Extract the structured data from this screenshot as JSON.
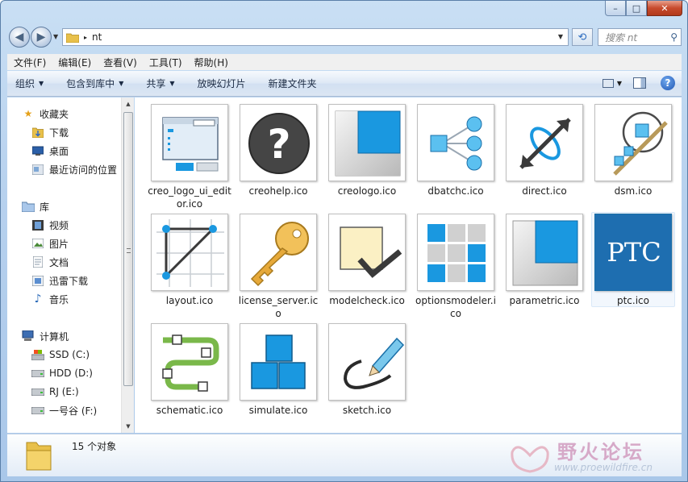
{
  "window": {
    "caption_minimize": "–",
    "caption_maximize": "□",
    "caption_close": "✕"
  },
  "address_bar": {
    "separator": "▸",
    "path": "nt",
    "search_placeholder": "搜索 nt"
  },
  "menu": [
    "文件(F)",
    "编辑(E)",
    "查看(V)",
    "工具(T)",
    "帮助(H)"
  ],
  "toolbar": {
    "organize": "组织",
    "include_in_library": "包含到库中",
    "share": "共享",
    "slideshow": "放映幻灯片",
    "new_folder": "新建文件夹"
  },
  "nav_pane": {
    "favorites": {
      "label": "收藏夹",
      "items": [
        "下载",
        "桌面",
        "最近访问的位置"
      ]
    },
    "libraries": {
      "label": "库",
      "items": [
        "视频",
        "图片",
        "文档",
        "迅雷下载",
        "音乐"
      ]
    },
    "computer": {
      "label": "计算机",
      "items": [
        "SSD (C:)",
        "HDD (D:)",
        "RJ (E:)",
        "一号谷 (F:)"
      ]
    }
  },
  "files": [
    {
      "name": "creo_logo_ui_editor.ico",
      "icon": "ui-editor-icon"
    },
    {
      "name": "creohelp.ico",
      "icon": "help-question-icon"
    },
    {
      "name": "creologo.ico",
      "icon": "creo-logo-icon"
    },
    {
      "name": "dbatchc.ico",
      "icon": "batch-nodes-icon"
    },
    {
      "name": "direct.ico",
      "icon": "direct-arrow-icon"
    },
    {
      "name": "dsm.ico",
      "icon": "dsm-icon"
    },
    {
      "name": "layout.ico",
      "icon": "layout-triangle-icon"
    },
    {
      "name": "license_server.ico",
      "icon": "key-icon"
    },
    {
      "name": "modelcheck.ico",
      "icon": "checkmark-icon"
    },
    {
      "name": "optionsmodeler.ico",
      "icon": "grid-options-icon"
    },
    {
      "name": "parametric.ico",
      "icon": "parametric-icon"
    },
    {
      "name": "ptc.ico",
      "icon": "ptc-logo-icon",
      "logo_text": "PTC"
    },
    {
      "name": "schematic.ico",
      "icon": "schematic-pipe-icon"
    },
    {
      "name": "simulate.ico",
      "icon": "simulate-blocks-icon"
    },
    {
      "name": "sketch.ico",
      "icon": "sketch-pen-icon"
    }
  ],
  "status": {
    "count": "15 个对象"
  },
  "watermark": {
    "title": "野火论坛",
    "url": "www.proewildfire.cn"
  },
  "colors": {
    "accent_blue": "#1a98e0",
    "selection": "#e5f1fb"
  }
}
